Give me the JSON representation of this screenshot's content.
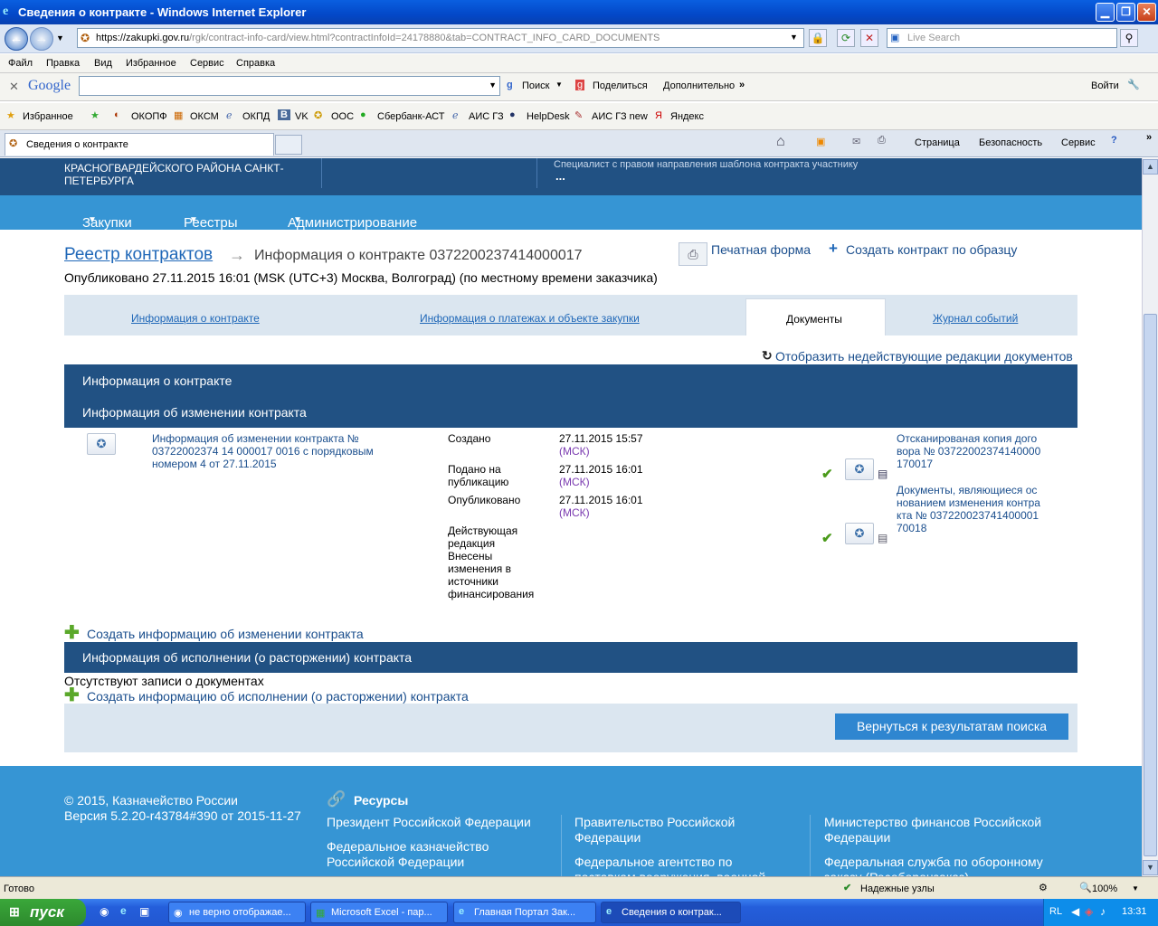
{
  "window": {
    "title": "Сведения о контракте - Windows Internet Explorer"
  },
  "address": {
    "url_host": "https://zakupki.gov.ru",
    "url_path": "/rgk/contract-info-card/view.html?contractInfoId=24178880&tab=CONTRACT_INFO_CARD_DOCUMENTS",
    "search_placeholder": "Live Search"
  },
  "menu": [
    "Файл",
    "Правка",
    "Вид",
    "Избранное",
    "Сервис",
    "Справка"
  ],
  "google_toolbar": {
    "logo": "Google",
    "search": "Поиск",
    "share": "Поделиться",
    "more": "Дополнительно",
    "login": "Войти"
  },
  "favorites": [
    "Избранное",
    "ОКОПФ",
    "ОКСМ",
    "ОКПД",
    "VK",
    "ООС",
    "Сбербанк-АСТ",
    "АИС ГЗ",
    "HelpDesk",
    "АИС ГЗ new",
    "Яндекс"
  ],
  "tab": {
    "title": "Сведения о контракте"
  },
  "cmdbar": {
    "page": "Страница",
    "safety": "Безопасность",
    "tools": "Сервис"
  },
  "header": {
    "org_line1": "КРАСНОГВАРДЕЙСКОГО РАЙОНА САНКТ-",
    "org_line2": "ПЕТЕРБУРГА",
    "role": "Специалист с правом направления шаблона контракта участнику",
    "ellipsis": "..."
  },
  "nav": [
    "Закупки",
    "Реестры",
    "Администрирование"
  ],
  "breadcrumb": {
    "root": "Реестр контрактов",
    "arrow": "→",
    "current": "Информация о контракте 0372200237414000017"
  },
  "print_form": "Печатная форма",
  "create_by_sample": "Создать контракт по образцу",
  "published": "Опубликовано 27.11.2015 16:01 (MSK (UTC+3) Москва, Волгоград) (по местному времени заказчика)",
  "tabs": [
    "Информация о контракте",
    "Информация о платежах и объекте закупки",
    "Документы",
    "Журнал событий"
  ],
  "show_inactive": "Отобразить недействующие редакции документов",
  "sec_contract_info": "Информация о контракте",
  "sec_change_info": "Информация об изменении контракта",
  "change_row": {
    "title": "Информация об изменении контракта № 03722002374 14 000017 0016 с порядковым номером 4 от 27.11.2015",
    "created_label": "Создано",
    "created_value": "27.11.2015 15:57",
    "created_tz": "(МСК)",
    "submitted_label": "Подано на публикацию",
    "submitted_value": "27.11.2015 16:01",
    "submitted_tz": "(МСК)",
    "published_label": "Опубликовано",
    "published_value": "27.11.2015 16:01",
    "published_tz": "(МСК)",
    "status": "Действующая редакция Внесены изменения в источники финансирования",
    "doc1": "Отсканированая копия договора № 03722002374140000170017",
    "doc2": "Документы, являющиеся основанием изменения контракта № 03722002374140000170018"
  },
  "create_change": "Создать информацию об изменении контракта",
  "sec_execution": "Информация об исполнении (о расторжении) контракта",
  "no_records": "Отсутствуют записи о документах",
  "create_execution": "Создать информацию об исполнении (о расторжении) контракта",
  "back_button": "Вернуться к результатам поиска",
  "footer": {
    "copyright": "© 2015, Казначейство России",
    "version": "Версия 5.2.20-r43784#390 от 2015-11-27",
    "resources": "Ресурсы",
    "links": [
      "Президент Российской Федерации",
      "Федеральное казначейство Российской Федерации",
      "Правительство Российской Федерации",
      "Федеральное агентство по поставкам вооружения, военной",
      "Министерство финансов Российской Федерации",
      "Федеральная служба по оборонному заказу (Рособоронзаказ)"
    ]
  },
  "status_bar": {
    "text": "Готово",
    "zone": "Надежные узлы",
    "zoom": "100%"
  },
  "taskbar": {
    "start": "пуск",
    "tasks": [
      "не верно отображае...",
      "Microsoft Excel - пар...",
      "Главная Портал Зак...",
      "Сведения о контрак..."
    ],
    "lang": "RL",
    "clock": "13:31"
  }
}
